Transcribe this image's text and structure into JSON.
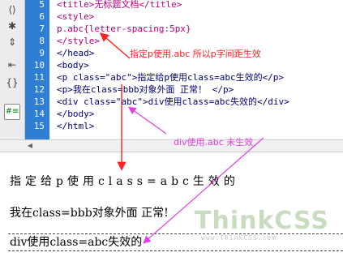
{
  "toolbar": {
    "icons": [
      "bracket-icon",
      "asterisk-icon",
      "collapse-icon",
      "indent-icon",
      "braces-icon",
      "format-icon"
    ]
  },
  "gutter": {
    "line_numbers": [
      "5",
      "6",
      "7",
      "8",
      "9",
      "10",
      "11",
      "12",
      "13",
      "14",
      "15"
    ]
  },
  "code": {
    "lines": [
      "<title>无标题文档</title>",
      "<style>",
      "p.abc{letter-spacing:5px}",
      "</style>",
      "</head>",
      "<body>",
      "<p class=\"abc\">指定给p使用class=abc生效的</p>",
      "<p>我在class=bbb对象外面 正常！ </p>",
      "<div class=\"abc\">div使用class=abc失效的</div>",
      "</body>",
      "</html>"
    ]
  },
  "annotations": {
    "a1": "指定p使用.abc 所以p字间距生效",
    "a2": "div使用.abc 未生效"
  },
  "design": {
    "line1": "指定给p使用class=abc生效的",
    "line2": "我在class=bbb对象外面 正常!",
    "line3": "div使用class=abc失效的"
  },
  "watermark": {
    "logo": "ThinkCSS",
    "url": "www.ThinkCSS.com"
  },
  "colors": {
    "gutter": "#2e7fd4",
    "tag": "#b0007a",
    "annotation_red": "#ff2222",
    "annotation_magenta": "#e040e0"
  }
}
